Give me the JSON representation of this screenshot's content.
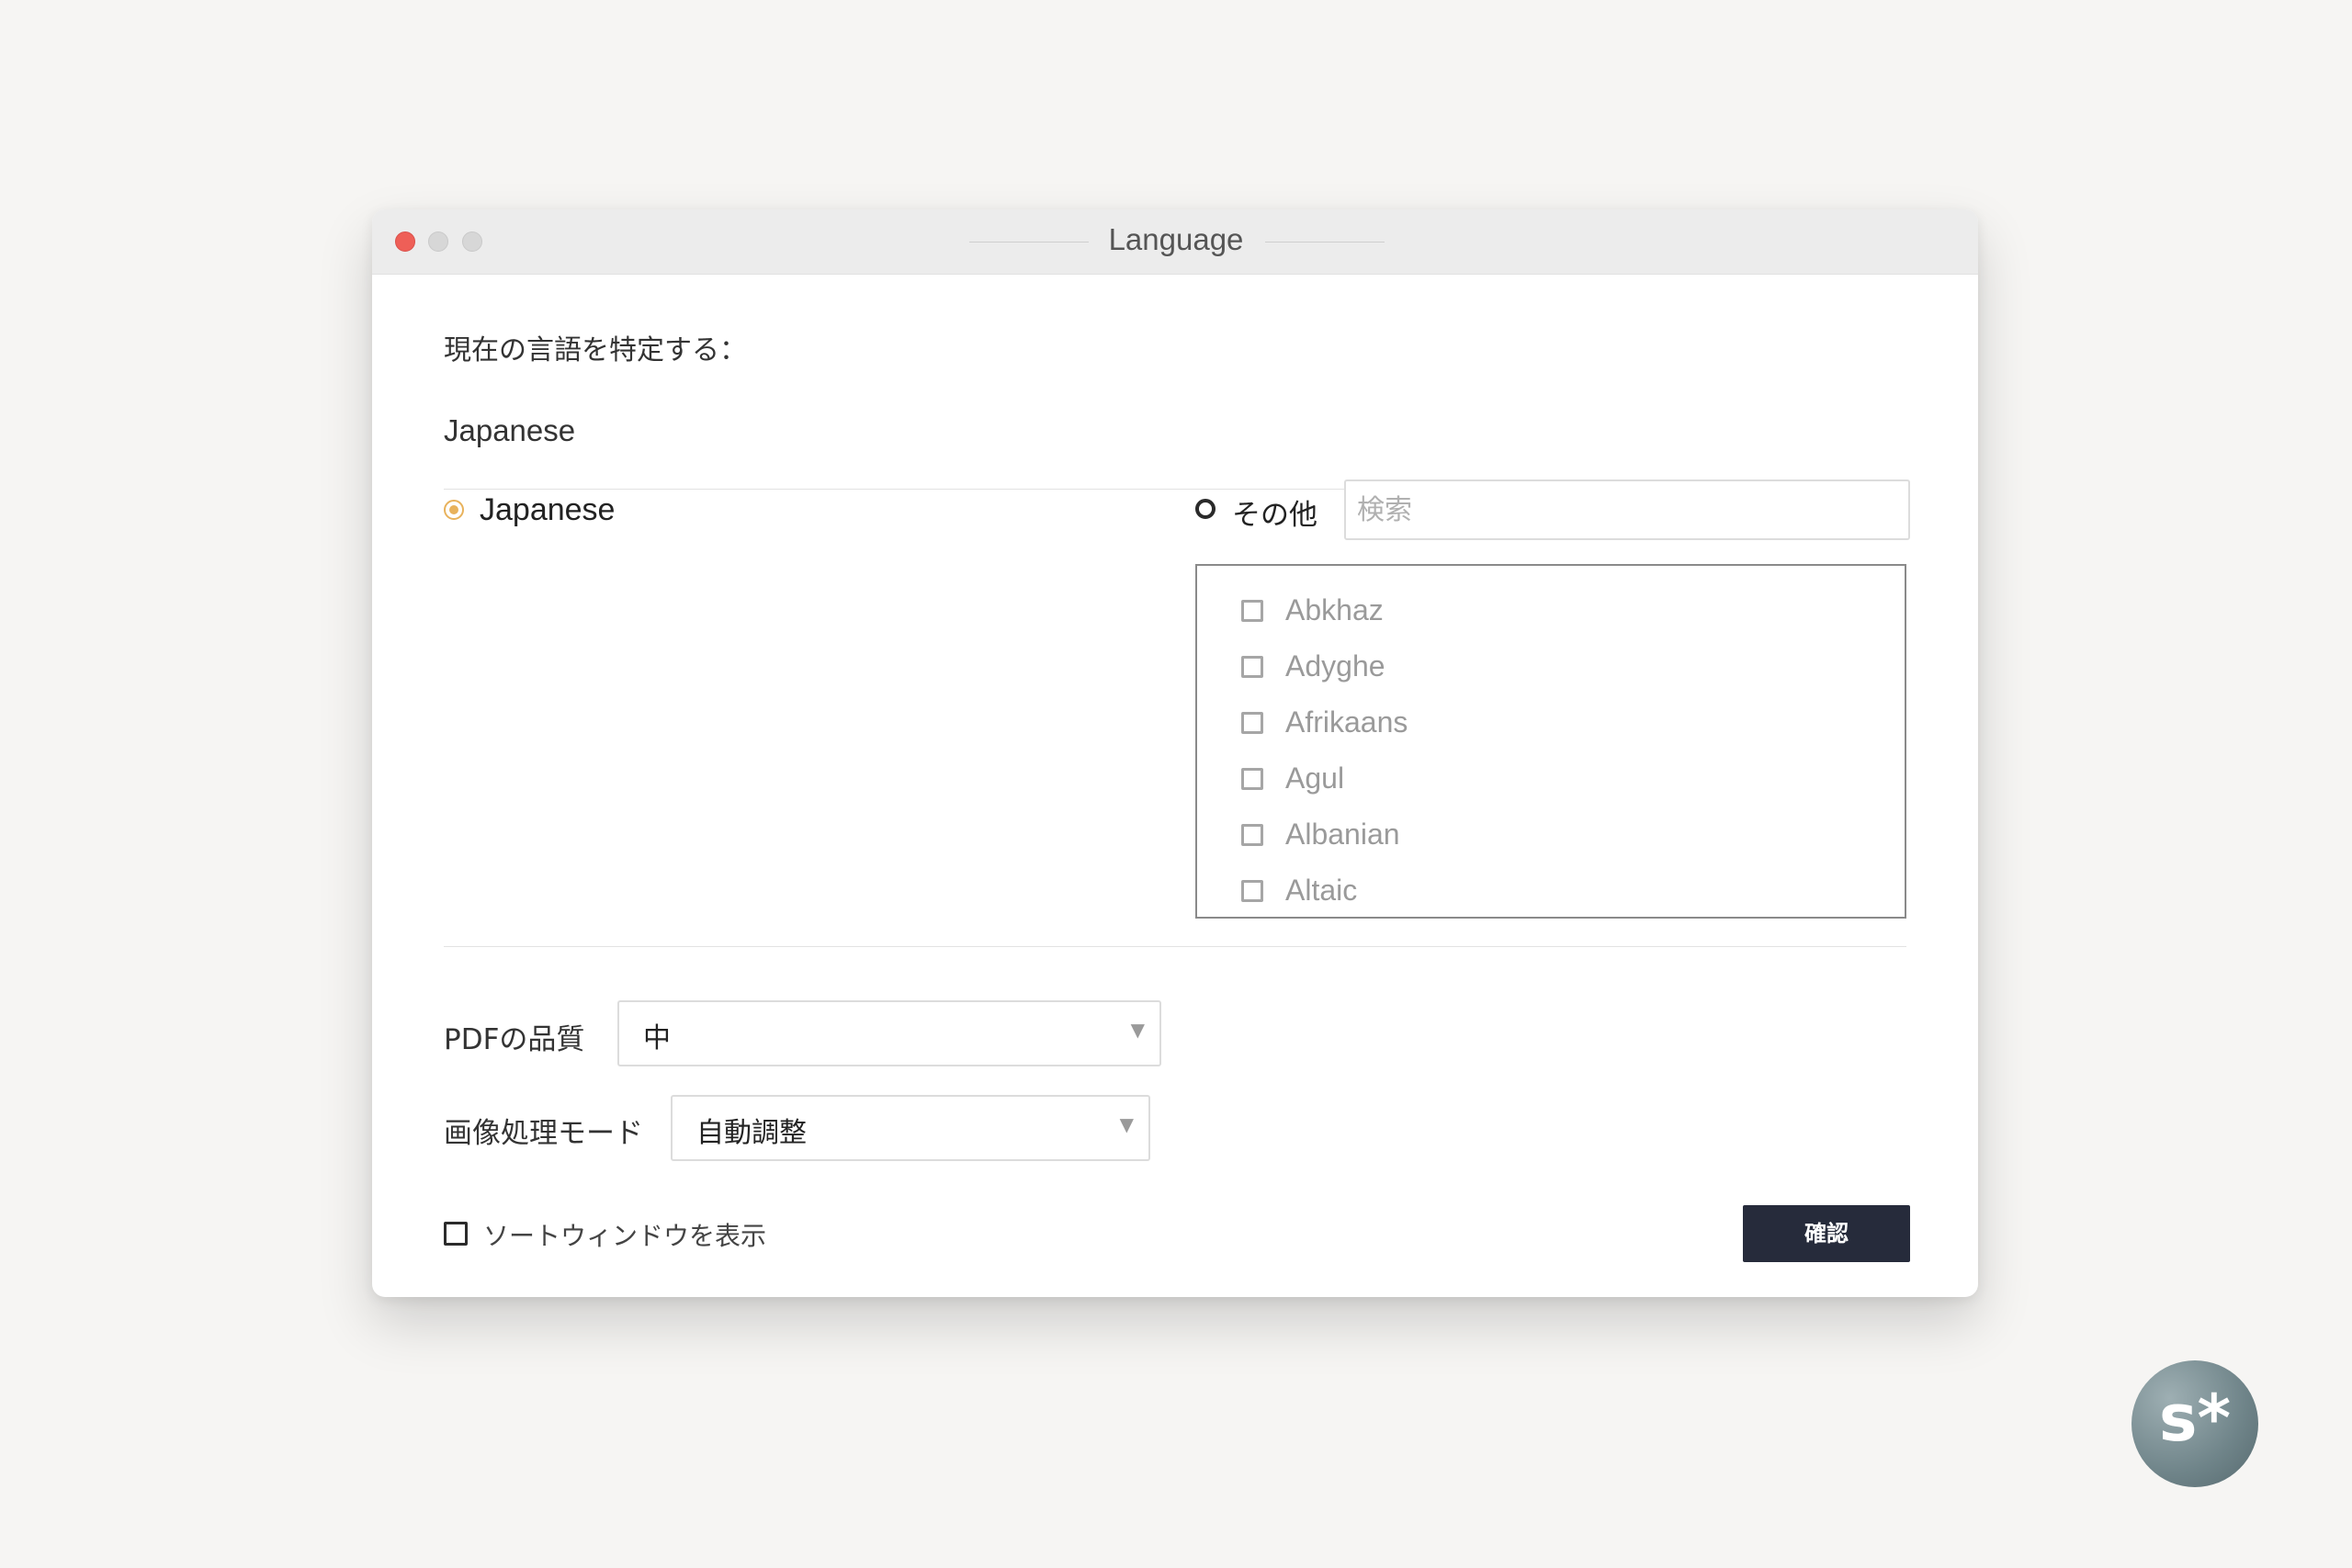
{
  "window": {
    "title": "Language"
  },
  "detect": {
    "hint": "現在の言語を特定する：",
    "current_language": "Japanese"
  },
  "options": {
    "japanese_label": "Japanese",
    "japanese_selected": true,
    "other_label": "その他",
    "other_selected": false,
    "search_placeholder": "検索",
    "search_value": ""
  },
  "language_list": [
    {
      "name": "Abkhaz",
      "checked": false
    },
    {
      "name": "Adyghe",
      "checked": false
    },
    {
      "name": "Afrikaans",
      "checked": false
    },
    {
      "name": "Agul",
      "checked": false
    },
    {
      "name": "Albanian",
      "checked": false
    },
    {
      "name": "Altaic",
      "checked": false
    }
  ],
  "pdf_quality": {
    "label": "PDFの品質",
    "value": "中"
  },
  "image_mode": {
    "label": "画像処理モード",
    "value": "自動調整"
  },
  "footer": {
    "show_sort_window_label": "ソートウィンドウを表示",
    "show_sort_window_checked": false,
    "confirm_label": "確認"
  },
  "badge": {
    "text": "s*"
  },
  "colors": {
    "accent_radio": "#e8b25c",
    "confirm_bg": "#262b3b",
    "close_button": "#ee5f57"
  }
}
